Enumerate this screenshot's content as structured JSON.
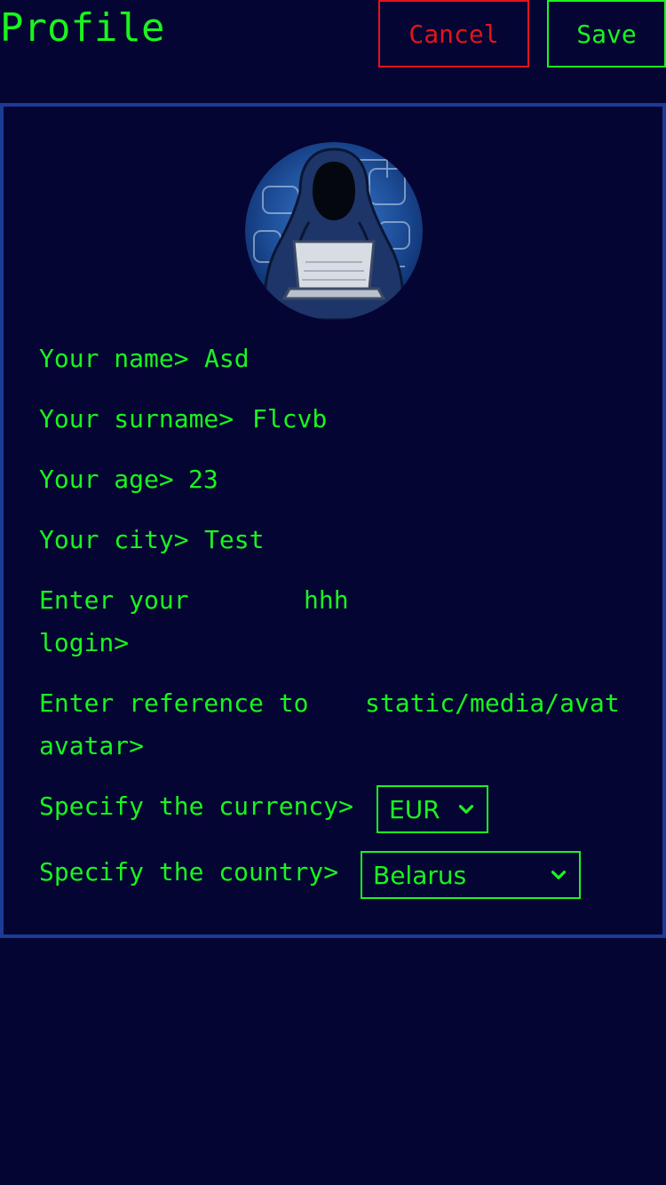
{
  "header": {
    "title": "Profile",
    "cancel_label": "Cancel",
    "save_label": "Save"
  },
  "profile": {
    "name_label": "Your name>",
    "name_value": "Asd",
    "surname_label": "Your surname>",
    "surname_value": "Flcvb",
    "age_label": "Your age>",
    "age_value": "23",
    "city_label": "Your city>",
    "city_value": "Test",
    "login_label_line1": "Enter your",
    "login_label_line2": "login>",
    "login_value": "hhh",
    "avatar_label_line1": "Enter reference to",
    "avatar_label_line2": "avatar>",
    "avatar_value": "static/media/avat",
    "currency_label": "Specify the currency>",
    "currency_value": "EUR",
    "country_label": "Specify the country>",
    "country_value": "Belarus"
  },
  "colors": {
    "background": "#050533",
    "text": "#19f51e",
    "cancel": "#e3141c",
    "panel_border": "#1b3c96"
  },
  "icons": {
    "avatar": "hooded-hacker-avatar-icon",
    "select_arrow": "chevron-down-icon"
  }
}
